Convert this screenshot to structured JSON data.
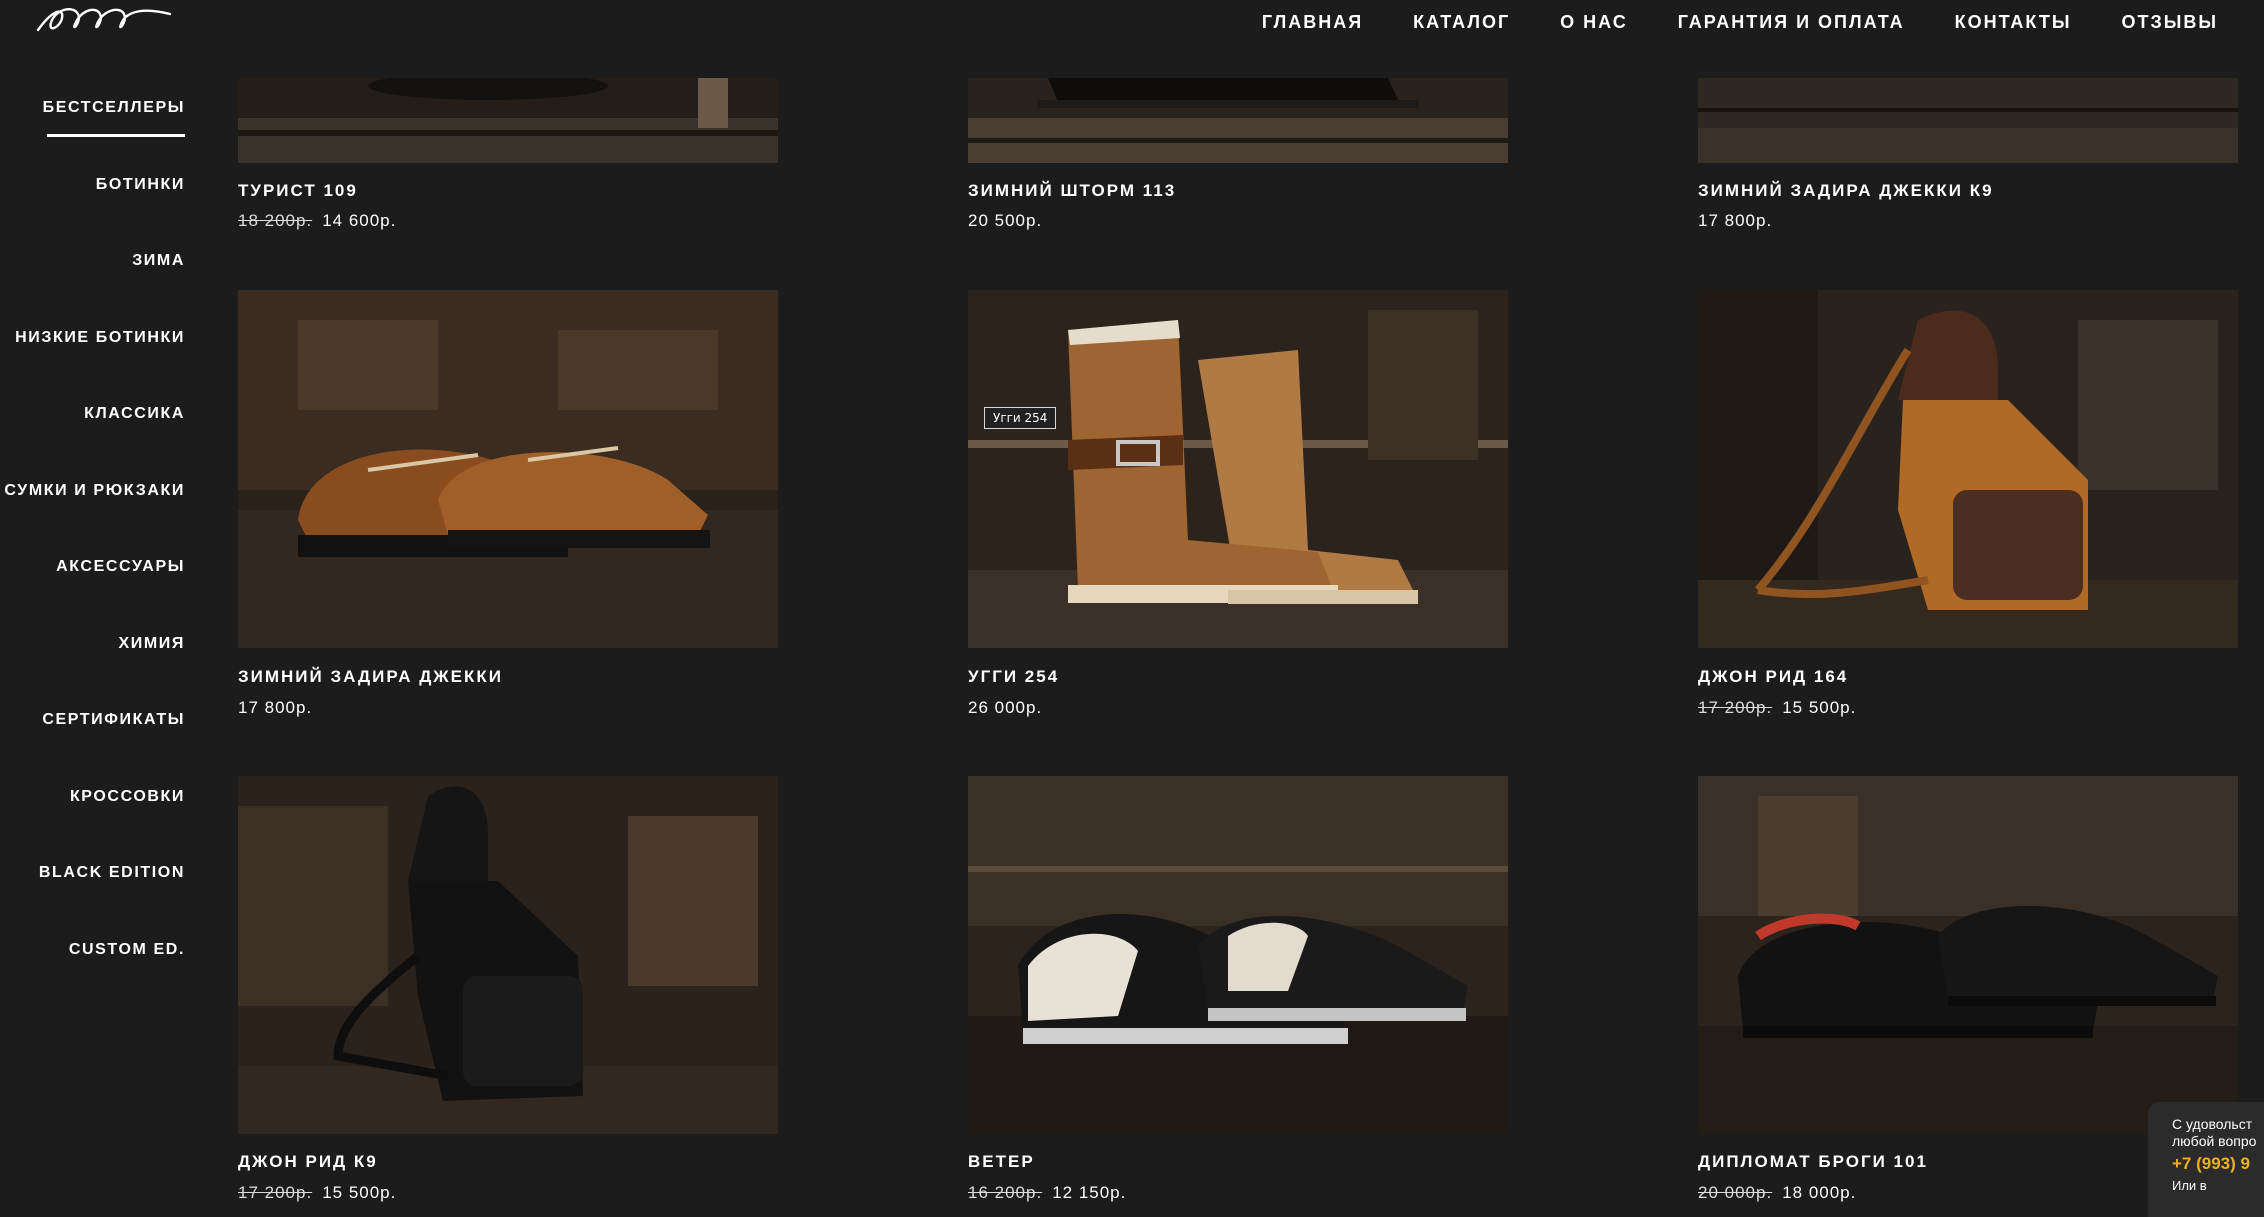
{
  "topnav": {
    "items": [
      "ГЛАВНАЯ",
      "КАТАЛОГ",
      "О НАС",
      "ГАРАНТИЯ И ОПЛАТА",
      "КОНТАКТЫ",
      "ОТЗЫВЫ"
    ]
  },
  "sidebar": {
    "items": [
      "БЕСТСЕЛЛЕРЫ",
      "БОТИНКИ",
      "ЗИМА",
      "НИЗКИЕ БОТИНКИ",
      "КЛАССИКА",
      "СУМКИ И РЮКЗАКИ",
      "АКСЕССУАРЫ",
      "ХИМИЯ",
      "СЕРТИФИКАТЫ",
      "КРОССОВКИ",
      "BLACK EDITION",
      "CUSTOM ED."
    ],
    "active_index": 0
  },
  "products": [
    {
      "name": "ТУРИСТ 109",
      "old_price": "18 200р.",
      "price": "14 600р."
    },
    {
      "name": "ЗИМНИЙ ШТОРМ 113",
      "old_price": "",
      "price": "20 500р."
    },
    {
      "name": "ЗИМНИЙ ЗАДИРА ДЖЕККИ К9",
      "old_price": "",
      "price": "17 800р."
    },
    {
      "name": "ЗИМНИЙ ЗАДИРА ДЖЕККИ",
      "old_price": "",
      "price": "17 800р."
    },
    {
      "name": "УГГИ 254",
      "old_price": "",
      "price": "26 000р.",
      "tooltip": "Угги 254"
    },
    {
      "name": "ДЖОН РИД 164",
      "old_price": "17 200р.",
      "price": "15 500р."
    },
    {
      "name": "ДЖОН РИД К9",
      "old_price": "17 200р.",
      "price": "15 500р."
    },
    {
      "name": "ВЕТЕР",
      "old_price": "16 200р.",
      "price": "12 150р."
    },
    {
      "name": "ДИПЛОМАТ БРОГИ 101",
      "old_price": "20 000р.",
      "price": "18 000р."
    }
  ],
  "chat": {
    "line1": "С удовольст",
    "line2": "любой вопро",
    "phone": "+7 (993) 9",
    "line3": "Или в"
  },
  "colors": {
    "background": "#1c1c1c",
    "phone_accent": "#f2b01e"
  }
}
